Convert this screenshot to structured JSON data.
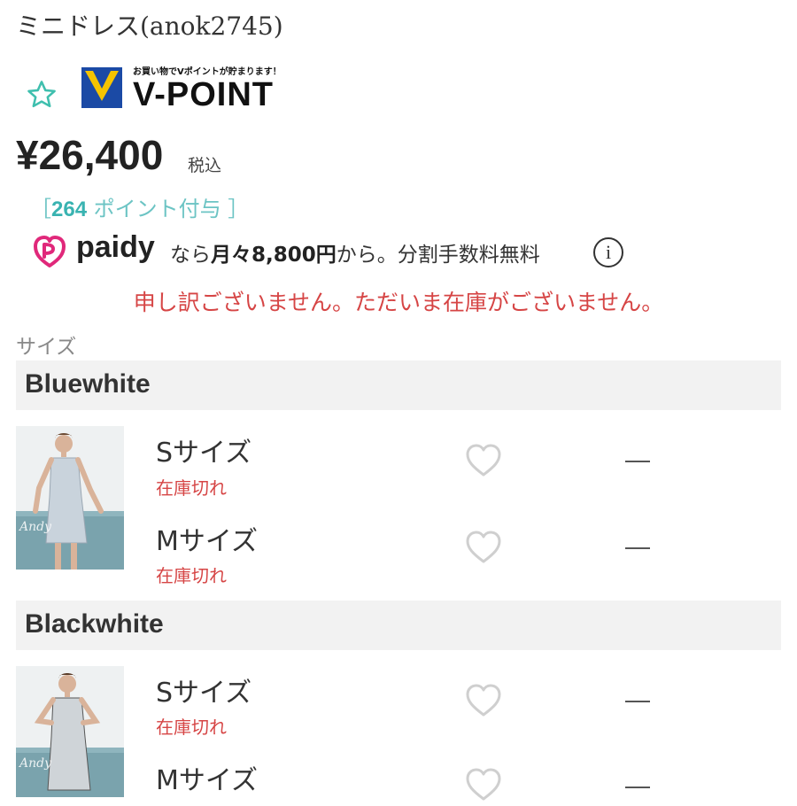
{
  "product": {
    "title": "ミニドレス(anok2745)",
    "price": "¥26,400",
    "tax_label": "税込",
    "points_prefix": "［",
    "points_value": "264",
    "points_suffix": " ポイント付与 ］"
  },
  "vpoint": {
    "tagline": "お買い物でVポイントが貯まります！",
    "logo_text": "V-POINT",
    "brand_colors": {
      "blue": "#1b4aa5",
      "yellow": "#f5c400"
    }
  },
  "paidy": {
    "brand": "paidy",
    "msg_prefix": "なら",
    "msg_amount": "月々8,800円",
    "msg_suffix": "から。分割手数料無料",
    "info_glyph": "i",
    "icon_color": "#e0287a"
  },
  "stock_message": "申し訳ございません。ただいま在庫がございません。",
  "size_section_label": "サイズ",
  "colors": [
    {
      "name": "Bluewhite",
      "thumb_watermark": "Andy",
      "sizes": [
        {
          "label": "Sサイズ",
          "status": "在庫切れ",
          "qty": "—"
        },
        {
          "label": "Mサイズ",
          "status": "在庫切れ",
          "qty": "—"
        }
      ]
    },
    {
      "name": "Blackwhite",
      "thumb_watermark": "Andy",
      "sizes": [
        {
          "label": "Sサイズ",
          "status": "在庫切れ",
          "qty": "—"
        },
        {
          "label": "Mサイズ",
          "status": "",
          "qty": "—"
        }
      ]
    }
  ],
  "theme": {
    "accent_teal": "#3fbfae",
    "error_red": "#d64545",
    "bar_gray": "#f2f2f2"
  }
}
